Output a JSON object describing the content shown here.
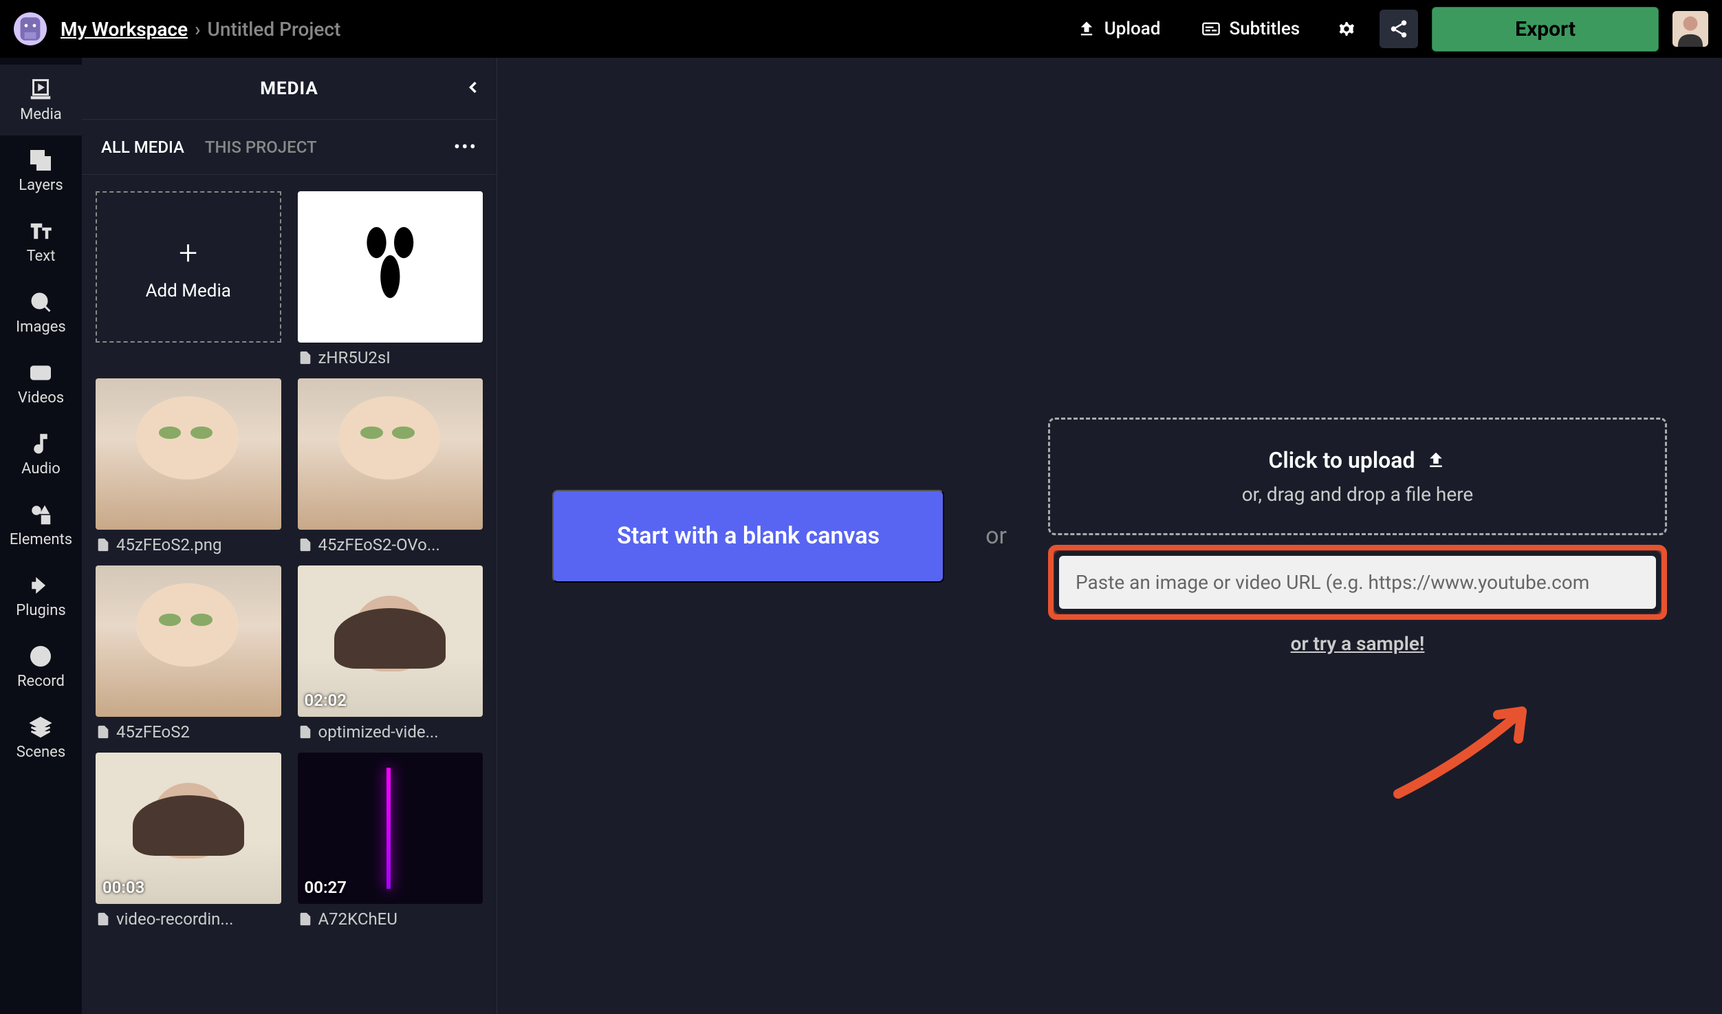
{
  "header": {
    "workspace": "My Workspace",
    "separator": "›",
    "project": "Untitled Project",
    "upload": "Upload",
    "subtitles": "Subtitles",
    "export": "Export"
  },
  "sidebar": {
    "items": [
      {
        "label": "Media",
        "icon": "media"
      },
      {
        "label": "Layers",
        "icon": "layers"
      },
      {
        "label": "Text",
        "icon": "text"
      },
      {
        "label": "Images",
        "icon": "images"
      },
      {
        "label": "Videos",
        "icon": "videos"
      },
      {
        "label": "Audio",
        "icon": "audio"
      },
      {
        "label": "Elements",
        "icon": "elements"
      },
      {
        "label": "Plugins",
        "icon": "plugins"
      },
      {
        "label": "Record",
        "icon": "record"
      },
      {
        "label": "Scenes",
        "icon": "scenes"
      }
    ]
  },
  "panel": {
    "title": "MEDIA",
    "tabs": [
      "ALL MEDIA",
      "THIS PROJECT"
    ],
    "add_media": "Add Media",
    "items": [
      {
        "name": "zHR5U2sI",
        "kind": "ghost",
        "dur": ""
      },
      {
        "name": "45zFEoS2.png",
        "kind": "baby",
        "dur": ""
      },
      {
        "name": "45zFEoS2-OVo...",
        "kind": "baby",
        "dur": ""
      },
      {
        "name": "45zFEoS2",
        "kind": "baby",
        "dur": ""
      },
      {
        "name": "optimized-vide...",
        "kind": "room",
        "dur": "02:02"
      },
      {
        "name": "video-recordin...",
        "kind": "room",
        "dur": "00:03"
      },
      {
        "name": "A72KChEU",
        "kind": "purple-vid",
        "dur": "00:27"
      }
    ]
  },
  "canvas": {
    "blank": "Start with a blank canvas",
    "or": "or",
    "upload_title": "Click to upload",
    "upload_sub": "or, drag and drop a file here",
    "url_placeholder": "Paste an image or video URL (e.g. https://www.youtube.com",
    "sample": "or try a sample!"
  }
}
